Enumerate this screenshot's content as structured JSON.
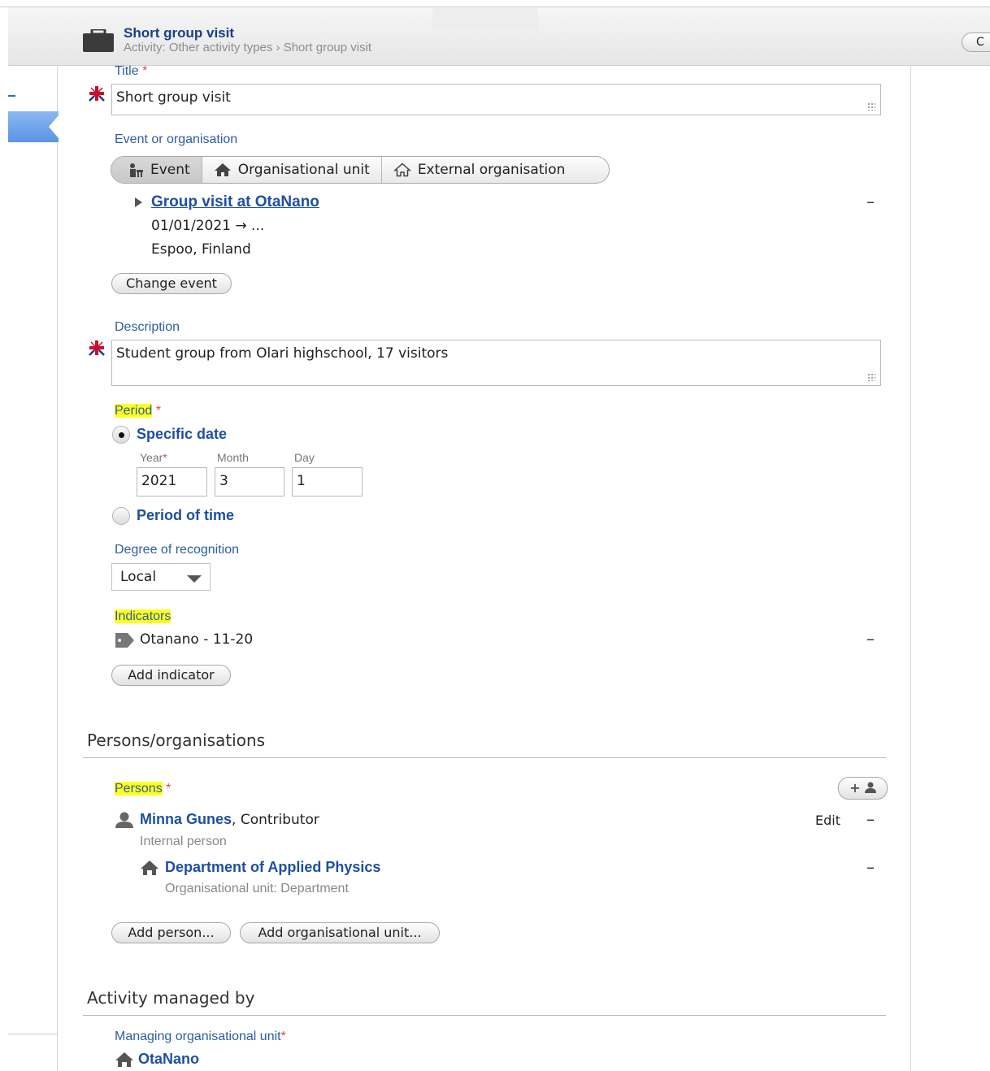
{
  "header": {
    "title": "Short group visit",
    "breadcrumb": "Activity: Other activity types › Short group visit",
    "right_button_label": "C",
    "briefcase_icon": "briefcase-icon"
  },
  "title_field": {
    "label": "Title",
    "required_mark": "*",
    "value": "Short group visit",
    "language_icon": "uk-flag-icon"
  },
  "event_or_org": {
    "label": "Event or organisation",
    "tabs": [
      {
        "label": "Event",
        "icon": "event-icon",
        "active": true
      },
      {
        "label": "Organisational unit",
        "icon": "house-icon",
        "active": false
      },
      {
        "label": "External organisation",
        "icon": "house-outline-icon",
        "active": false
      }
    ],
    "event": {
      "name": "Group visit at OtaNano",
      "dates": "01/01/2021 → ...",
      "location": "Espoo, Finland"
    },
    "change_button": "Change event",
    "remove_symbol": "–"
  },
  "description": {
    "label": "Description",
    "value": "Student group from Olari highschool, 17 visitors"
  },
  "period": {
    "label": "Period",
    "required_mark": "*",
    "options": [
      "Specific date",
      "Period of time"
    ],
    "selected": "Specific date",
    "year_label": "Year",
    "month_label": "Month",
    "day_label": "Day",
    "year": "2021",
    "month": "3",
    "day": "1"
  },
  "recognition": {
    "label": "Degree of recognition",
    "value": "Local"
  },
  "indicators": {
    "label": "Indicators",
    "items": [
      "Otanano - 11-20"
    ],
    "add_button": "Add indicator"
  },
  "persons_section": {
    "heading": "Persons/organisations",
    "persons_label": "Persons",
    "required_mark": "*",
    "add_person_icon_label": "+",
    "person": {
      "name": "Minna Gunes",
      "role": ", Contributor",
      "type": "Internal person",
      "edit_label": "Edit"
    },
    "org": {
      "name": "Department of Applied Physics",
      "type": "Organisational unit: Department"
    },
    "add_person_button": "Add person...",
    "add_org_button": "Add organisational unit..."
  },
  "managed_section": {
    "heading": "Activity managed by",
    "label": "Managing organisational unit",
    "required_mark": "*",
    "unit": "OtaNano"
  },
  "colors": {
    "link": "#1e4fa3",
    "label": "#2c5ea0",
    "highlight": "#ffff22",
    "required": "#d64a4a"
  }
}
